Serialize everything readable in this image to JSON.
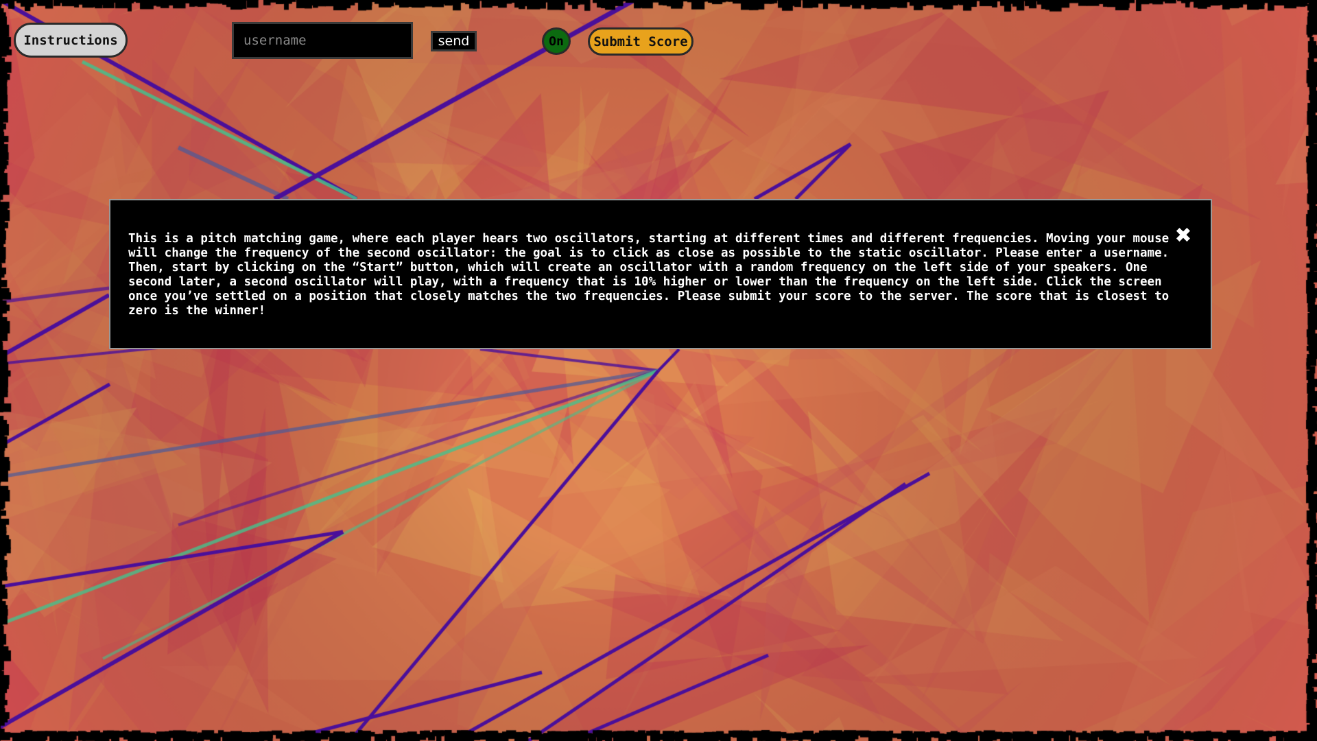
{
  "toolbar": {
    "instructions_label": "Instructions",
    "username_placeholder": "username",
    "username_value": "",
    "send_label": "send",
    "on_label": "On",
    "submit_label": "Submit Score"
  },
  "modal": {
    "text": "This is a pitch matching game, where each player hears two oscillators, starting at different times and different frequencies. Moving your mouse will change the frequency of the second oscillator: the goal is to click as close as possible to the static oscillator. Please enter a username. Then, start by clicking on the “Start” button, which will create an oscillator with a random frequency on the left side of your speakers. One second later, a second oscillator will play, with a frequency that is 10% higher or lower than the frequency on the left side. Click the screen once you’ve settled on a position that closely matches the two frequencies. Please submit your score to the server. The score that is closest to zero is the winner!",
    "close_glyph": "✖"
  },
  "colors": {
    "background_base": "#d9744e",
    "warm_pink": "#c83a55",
    "warm_orange": "#e0a052",
    "line_purple": "#4a0f9a",
    "line_teal": "#46c08c",
    "line_slate": "#4a5a9a",
    "on_green": "#0c6a10",
    "submit_orange": "#e8a21c"
  },
  "icons": {
    "close": "close-icon"
  }
}
